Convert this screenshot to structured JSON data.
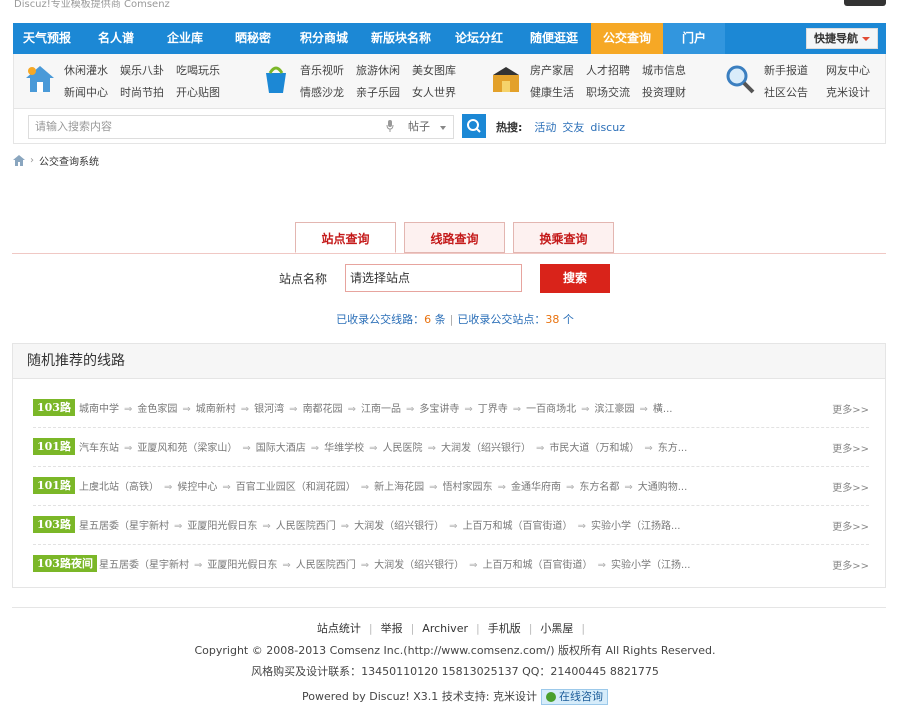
{
  "top": {
    "left_text": "Discuz!专业模板提供商",
    "left_tag": "Comsenz"
  },
  "nav": {
    "items": [
      "天气预报",
      "名人谱",
      "企业库",
      "晒秘密",
      "积分商城",
      "新版块名称",
      "论坛分红",
      "随便逛逛",
      "公交查询",
      "门户"
    ],
    "active_index": 8,
    "quick_label": "快捷导航"
  },
  "subnav": {
    "groups": [
      {
        "icon": "house-icon",
        "links": [
          "休闲灌水",
          "娱乐八卦",
          "吃喝玩乐",
          "新闻中心",
          "时尚节拍",
          "开心贴图"
        ]
      },
      {
        "icon": "pail-icon",
        "links": [
          "音乐视听",
          "旅游休闲",
          "美女图库",
          "情感沙龙",
          "亲子乐园",
          "女人世界"
        ]
      },
      {
        "icon": "box-icon",
        "links": [
          "房产家居",
          "人才招聘",
          "城市信息",
          "健康生活",
          "职场交流",
          "投资理财"
        ]
      },
      {
        "icon": "magnifier-icon",
        "links": [
          "新手报道",
          "网友中心",
          "社区公告",
          "克米设计"
        ]
      }
    ]
  },
  "search": {
    "placeholder": "请输入搜索内容",
    "type_label": "帖子",
    "hot_label": "热搜:",
    "hot_items": [
      "活动",
      "交友",
      "discuz"
    ]
  },
  "breadcrumb": {
    "current": "公交查询系统"
  },
  "tabs": [
    "站点查询",
    "线路查询",
    "换乘查询"
  ],
  "query": {
    "label": "站点名称",
    "input_value": "请选择站点",
    "button": "搜索"
  },
  "stats": {
    "routes_label": "已收录公交线路：",
    "routes_count": "6",
    "routes_unit": "条",
    "stops_label": "已收录公交站点：",
    "stops_count": "38",
    "stops_unit": "个"
  },
  "panel": {
    "title": "随机推荐的线路",
    "more_label": "更多>>",
    "routes": [
      {
        "name": "103路",
        "stops": [
          "城南中学",
          "金色家园",
          "城南新村",
          "银河湾",
          "南都花园",
          "江南一品",
          "多宝讲寺",
          "丁界寺",
          "一百商场北",
          "滨江豪园",
          "橫..."
        ]
      },
      {
        "name": "101路",
        "stops": [
          "汽车东站",
          "亚厦风和苑（梁家山）",
          "国际大酒店",
          "华维学校",
          "人民医院",
          "大润发（绍兴银行）",
          "市民大道（万和城）",
          "东方..."
        ]
      },
      {
        "name": "101路",
        "stops": [
          "上虞北站（高铁）",
          "候控中心",
          "百官工业园区（和润花园）",
          "新上海花园",
          "悟村家园东",
          "金通华府南",
          "东方名都",
          "大通购物..."
        ]
      },
      {
        "name": "103路",
        "stops": [
          "星五居委（星宇新村",
          "亚厦阳光假日东",
          "人民医院西门",
          "大润发（绍兴银行）",
          "上百万和城（百官街道）",
          "实验小学（江扬路..."
        ]
      },
      {
        "name": "103路夜间",
        "stops": [
          "星五居委（星宇新村",
          "亚厦阳光假日东",
          "人民医院西门",
          "大润发（绍兴银行）",
          "上百万和城（百官街道）",
          "实验小学（江扬..."
        ]
      }
    ]
  },
  "footer": {
    "links": [
      "站点统计",
      "举报",
      "Archiver",
      "手机版",
      "小黑屋"
    ],
    "copyright": "Copyright © 2008-2013 Comsenz Inc.(http://www.comsenz.com/) 版权所有 All Rights Reserved.",
    "contact": "风格购买及设计联系：13450110120 15813025137 QQ：21400445 8821775",
    "powered": "Powered by Discuz! X3.1  技术支持: 克米设计",
    "online_label": "在线咨询"
  },
  "colors": {
    "nav_blue": "#1c88d5",
    "active_orange": "#f6a825",
    "accent_red": "#d9231a",
    "badge_green": "#7bb728"
  }
}
